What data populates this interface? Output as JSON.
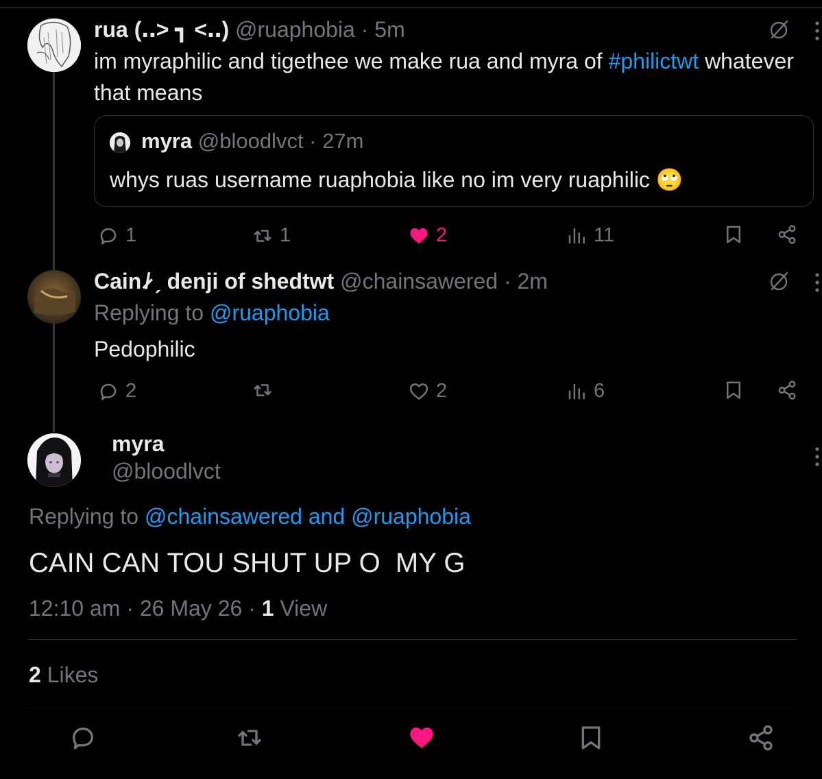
{
  "tweet1": {
    "display_name": "rua (‥> ┓ <‥)",
    "handle": "@ruaphobia",
    "time": "· 5m",
    "text_before": "im myraphilic and tigethee we make rua and myra of ",
    "hashtag": "#philictwt",
    "text_after": " whatever that means",
    "quote": {
      "display_name": "myra",
      "handle": "@bloodlvct",
      "time": "· 27m",
      "text": "whys ruas username ruaphobia like no im very ruaphilic",
      "emoji": "🙄"
    },
    "actions": {
      "replies": "1",
      "reposts": "1",
      "likes": "2",
      "views": "11"
    }
  },
  "tweet2": {
    "display_name": "Cain ̷̸̷̸ ˏ denji of shedtwt",
    "handle": "@chainsawered",
    "time": "· 2m",
    "replying_prefix": "Replying to ",
    "replying_to": "@ruaphobia",
    "text": "Pedophilic",
    "actions": {
      "replies": "2",
      "reposts": "",
      "likes": "2",
      "views": "6"
    }
  },
  "main_tweet": {
    "display_name": "myra",
    "handle": "@bloodlvct",
    "replying_prefix": "Replying to ",
    "replying_to": "@chainsawered and @ruaphobia",
    "text": "CAIN CAN TOU SHUT UP O  MY G",
    "timestamp": "12:10 am · 26 May 26 · ",
    "views_count": "1",
    "views_label": " View",
    "likes_count": "2",
    "likes_label": " Likes"
  },
  "colors": {
    "accent": "#1d9bf0",
    "like": "#f91880",
    "muted": "#71767b",
    "background": "#000000"
  },
  "icons": {
    "more": "more-vertical-icon",
    "grok": "grok-icon",
    "reply": "reply-icon",
    "repost": "repost-icon",
    "like": "heart-icon",
    "views": "views-icon",
    "bookmark": "bookmark-icon",
    "share": "share-icon"
  }
}
